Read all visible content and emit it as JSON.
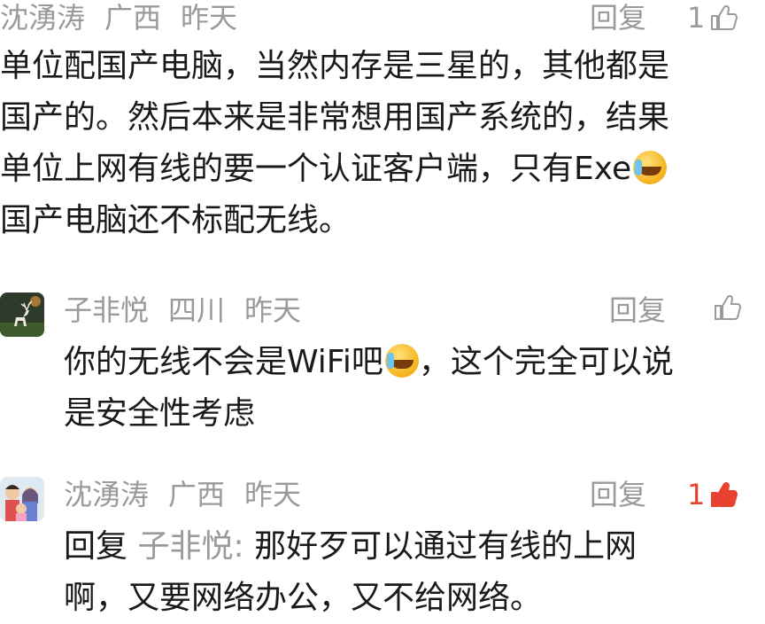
{
  "comments": [
    {
      "author": "沈湧涛",
      "location": "广西",
      "time": "昨天",
      "reply_label": "回复",
      "likes": "1",
      "liked": false,
      "lines": [
        "单位配国产电脑，当然内存是三星的，其他都是",
        "国产的。然后本来是非常想用国产系统的，结果",
        "单位上网有线的要一个认证客户端，只有Exe",
        "国产电脑还不标配无线。"
      ]
    },
    {
      "author": "子非悦",
      "location": "四川",
      "time": "昨天",
      "reply_label": "回复",
      "likes": "",
      "liked": false,
      "lines": [
        "你的无线不会是WiFi吧",
        "，这个完全可以说",
        "是安全性考虑"
      ]
    },
    {
      "author": "沈湧涛",
      "location": "广西",
      "time": "昨天",
      "reply_label": "回复",
      "likes": "1",
      "liked": true,
      "reply_prefix": "回复",
      "reply_to": "子非悦:",
      "lines": [
        "那好歹可以通过有线的上网",
        "啊，又要网络办公，又不给网络。"
      ]
    }
  ],
  "icons": {
    "like": "thumbs-up-icon",
    "emoji": "laughing-crying-emoji-icon"
  },
  "colors": {
    "meta": "#9a9a9a",
    "liked": "#e8412f",
    "text": "#1a1a1a"
  }
}
